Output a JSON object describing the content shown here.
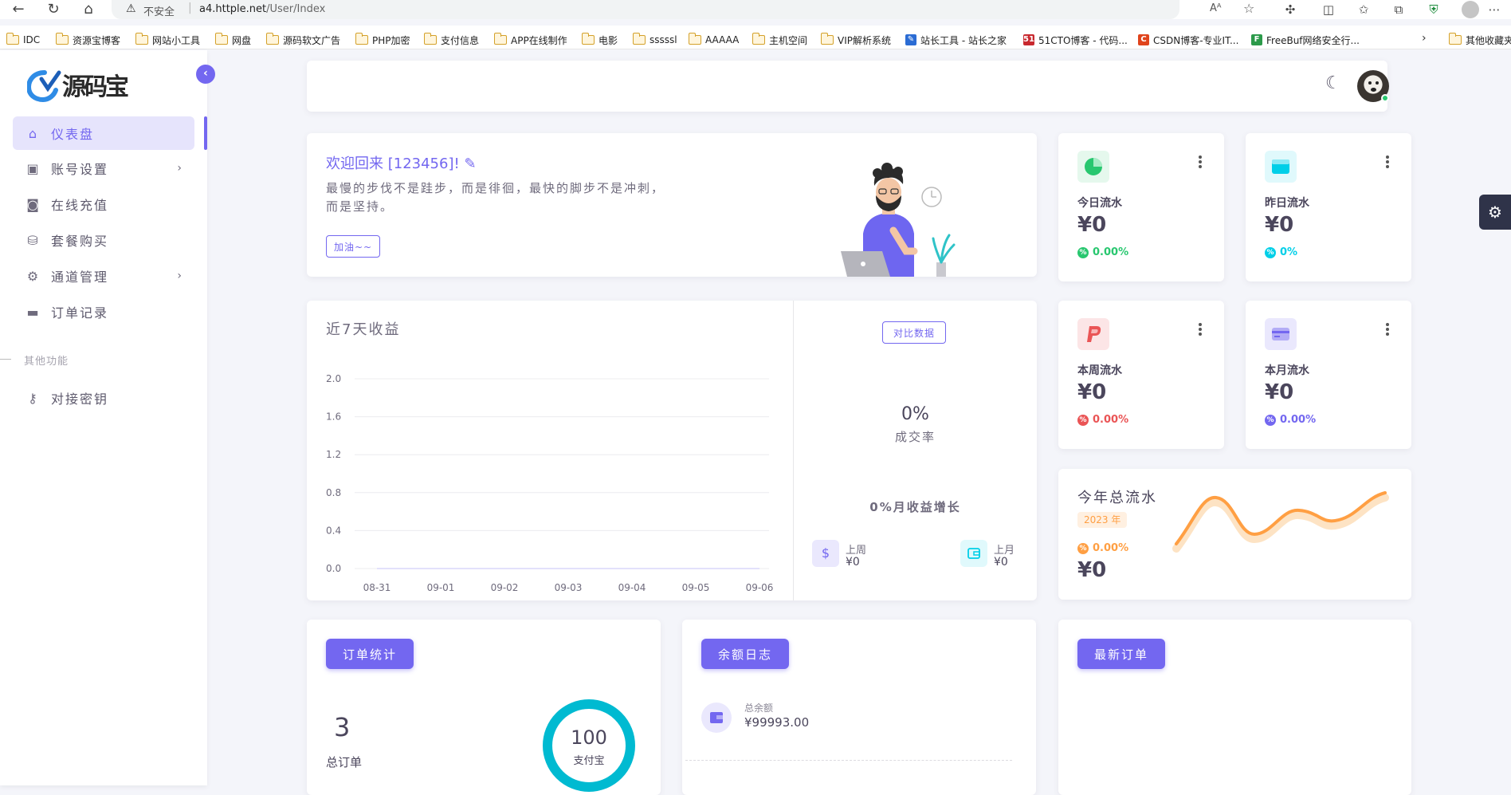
{
  "browser": {
    "security_label": "不安全",
    "url_host": "a4.httple.net",
    "url_path": "/User/Index"
  },
  "bookmarks": [
    {
      "label": "IDC",
      "icon": "folder-icon"
    },
    {
      "label": "资源宝博客",
      "icon": "folder-icon"
    },
    {
      "label": "网站小工具",
      "icon": "folder-icon"
    },
    {
      "label": "网盘",
      "icon": "folder-icon"
    },
    {
      "label": "源码软文广告",
      "icon": "folder-icon"
    },
    {
      "label": "PHP加密",
      "icon": "folder-icon"
    },
    {
      "label": "支付信息",
      "icon": "folder-icon"
    },
    {
      "label": "APP在线制作",
      "icon": "folder-icon"
    },
    {
      "label": "电影",
      "icon": "folder-icon"
    },
    {
      "label": "sssssl",
      "icon": "folder-icon"
    },
    {
      "label": "AAAAA",
      "icon": "folder-icon"
    },
    {
      "label": "主机空间",
      "icon": "folder-icon"
    },
    {
      "label": "VIP解析系统",
      "icon": "folder-icon"
    },
    {
      "label": "站长工具 - 站长之家",
      "icon": "site-icon"
    },
    {
      "label": "51CTO博客 - 代码...",
      "icon": "site-icon"
    },
    {
      "label": "CSDN博客-专业IT...",
      "icon": "site-icon"
    },
    {
      "label": "FreeBuf网络安全行...",
      "icon": "site-icon"
    },
    {
      "label": "其他收藏夹",
      "icon": "folder-icon"
    }
  ],
  "sidebar": {
    "items": [
      {
        "label": "仪表盘",
        "icon": "home-icon"
      },
      {
        "label": "账号设置",
        "icon": "user-card-icon"
      },
      {
        "label": "在线充值",
        "icon": "camera-icon"
      },
      {
        "label": "套餐购买",
        "icon": "bag-icon"
      },
      {
        "label": "通道管理",
        "icon": "gear-icon"
      },
      {
        "label": "订单记录",
        "icon": "wallet-icon"
      }
    ],
    "section_label": "其他功能",
    "extra_items": [
      {
        "label": "对接密钥",
        "icon": "key-icon"
      }
    ]
  },
  "welcome": {
    "title": "欢迎回来 [123456]!",
    "line1": "最慢的步伐不是跬步，而是徘徊，最快的脚步不是冲刺，",
    "line2": "而是坚持。",
    "button": "加油~~"
  },
  "stats": {
    "today": {
      "title": "今日流水",
      "value": "¥0",
      "pct": "0.00%",
      "color": "#28c76f"
    },
    "yesterday": {
      "title": "昨日流水",
      "value": "¥0",
      "pct": "0%",
      "color": "#00cfe8"
    },
    "week": {
      "title": "本周流水",
      "value": "¥0",
      "pct": "0.00%",
      "color": "#ea5455"
    },
    "month": {
      "title": "本月流水",
      "value": "¥0",
      "pct": "0.00%",
      "color": "#7367f0"
    }
  },
  "year_card": {
    "title": "今年总流水",
    "badge": "2023 年",
    "pct": "0.00%",
    "value": "¥0",
    "line_color": "#ff9f43"
  },
  "revenue": {
    "title": "近7天收益",
    "compare_button": "对比数据",
    "rate_value": "0%",
    "rate_label": "成交率",
    "growth": "0%月收益增长",
    "last_week_label": "上周",
    "last_week_value": "¥0",
    "last_month_label": "上月",
    "last_month_value": "¥0"
  },
  "chart_data": {
    "type": "line",
    "categories": [
      "08-31",
      "09-01",
      "09-02",
      "09-03",
      "09-04",
      "09-05",
      "09-06"
    ],
    "series": [
      {
        "values": [
          0,
          0,
          0,
          0,
          0,
          0,
          0
        ]
      }
    ],
    "yticks": [
      "2.0",
      "1.6",
      "1.2",
      "0.8",
      "0.4",
      "0.0"
    ],
    "ylim": [
      0,
      2.0
    ],
    "grid": true
  },
  "orders": {
    "button": "订单统计",
    "count": "3",
    "count_label": "总订单",
    "ring_value": "100",
    "ring_label": "支付宝",
    "ring_color": "#00bad1"
  },
  "balance": {
    "button": "余额日志",
    "label": "总余额",
    "value": "¥99993.00"
  },
  "latest": {
    "button": "最新订单"
  }
}
